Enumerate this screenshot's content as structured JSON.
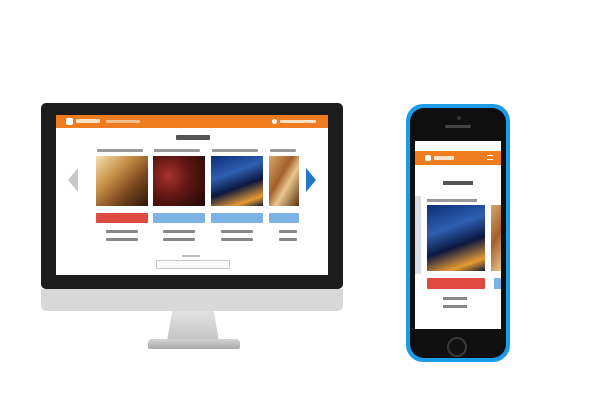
{
  "desktop": {
    "header_color": "#ef7d1f",
    "cards": [
      {
        "image": "restaurant-interior-photo",
        "button_color": "#df4a40"
      },
      {
        "image": "red-bar-interior-photo",
        "button_color": "#7db2e5"
      },
      {
        "image": "night-city-view-photo",
        "button_color": "#7db2e5"
      },
      {
        "image": "warm-dining-photo",
        "button_color": "#7db2e5"
      }
    ],
    "nav_arrows": {
      "prev_color": "#c8c8c8",
      "next_color": "#1f77c6"
    }
  },
  "mobile": {
    "frame_color": "#1d9be6",
    "header_color": "#ef7d1f",
    "featured_card": {
      "image": "night-city-view-photo",
      "button_color": "#df4a40"
    }
  }
}
